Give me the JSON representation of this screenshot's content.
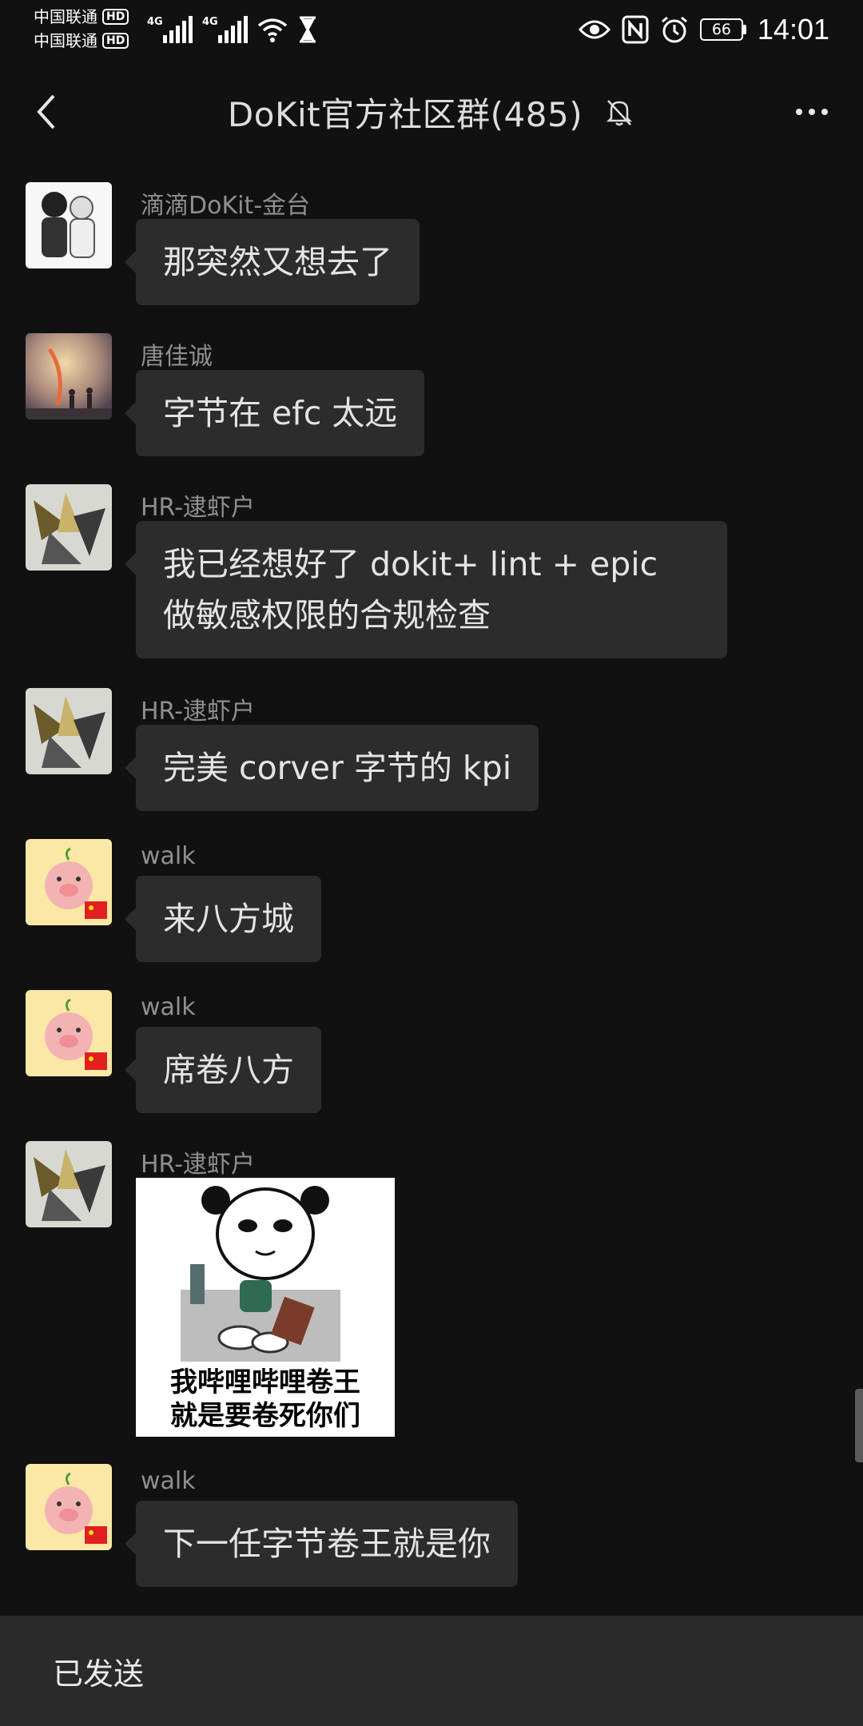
{
  "status_bar": {
    "carrier_1": "中国联通",
    "carrier_2": "中国联通",
    "hd_label": "HD",
    "network_label": "4G",
    "battery": "66",
    "time": "14:01"
  },
  "header": {
    "title": "DoKit官方社区群(485)"
  },
  "messages": [
    {
      "sender": "滴滴DoKit-金台",
      "text": "那突然又想去了"
    },
    {
      "sender": "唐佳诚",
      "text": "字节在 efc 太远"
    },
    {
      "sender": "HR-逮虾户",
      "text": "我已经想好了 dokit+ lint + epic 做敏感权限的合规检查"
    },
    {
      "sender": "HR-逮虾户",
      "text": "完美 corver 字节的 kpi"
    },
    {
      "sender": "walk",
      "text": "来八方城"
    },
    {
      "sender": "walk",
      "text": "席卷八方"
    },
    {
      "sender": "HR-逮虾户",
      "sticker_text_1": "我哔哩哔哩卷王",
      "sticker_text_2": "就是要卷死你们"
    },
    {
      "sender": "walk",
      "text": "下一任字节卷王就是你"
    }
  ],
  "bottom_bar": {
    "text": "已发送"
  },
  "colors": {
    "background": "#111111",
    "bubble": "#2c2c2c",
    "sender_name": "#8f8f8f",
    "bottom_bar": "#2a2a2a"
  },
  "icons": [
    "back-icon",
    "mute-bell-icon",
    "more-icon",
    "wifi-icon",
    "hourglass-icon",
    "eye-icon",
    "nfc-icon",
    "alarm-icon",
    "battery-icon"
  ]
}
